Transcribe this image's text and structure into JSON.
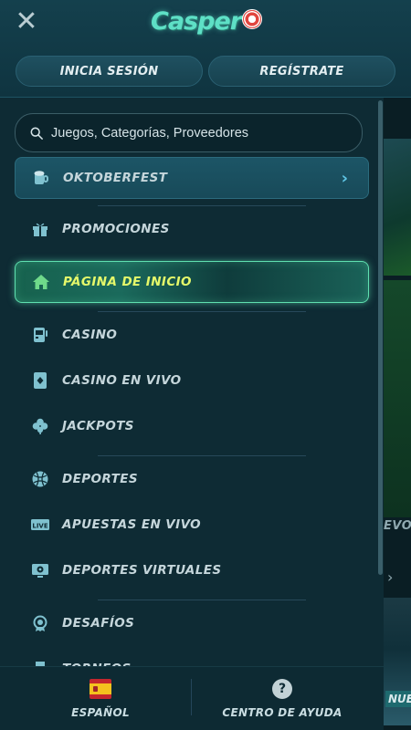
{
  "header": {
    "logo_text": "Casper",
    "login_label": "INICIA SESIÓN",
    "register_label": "REGÍSTRATE"
  },
  "search": {
    "placeholder": "Juegos, Categorías, Proveedores"
  },
  "menu": {
    "items": [
      {
        "label": "OKTOBERFEST",
        "icon": "beer-mug-icon"
      },
      {
        "label": "PROMOCIONES",
        "icon": "gift-icon"
      },
      {
        "label": "PÁGINA DE INICIO",
        "icon": "home-icon"
      },
      {
        "label": "CASINO",
        "icon": "slot-machine-icon"
      },
      {
        "label": "CASINO EN VIVO",
        "icon": "playing-card-icon"
      },
      {
        "label": "JACKPOTS",
        "icon": "clover-icon"
      },
      {
        "label": "DEPORTES",
        "icon": "ball-icon"
      },
      {
        "label": "APUESTAS EN VIVO",
        "icon": "live-icon"
      },
      {
        "label": "DEPORTES VIRTUALES",
        "icon": "monitor-ball-icon"
      },
      {
        "label": "DESAFÍOS",
        "icon": "medal-icon"
      },
      {
        "label": "TORNEOS",
        "icon": "trophy-icon"
      }
    ]
  },
  "footer": {
    "language_label": "ESPAÑOL",
    "help_label": "CENTRO DE AYUDA",
    "help_glyph": "?"
  },
  "background": {
    "label_1": "EVOS",
    "label_2": "NUEV"
  },
  "colors": {
    "drawer_bg": "#0e2b34",
    "accent_teal": "#5fe0b0",
    "active_text": "#e5f86a",
    "featured_chevron": "#5fc6e6"
  }
}
